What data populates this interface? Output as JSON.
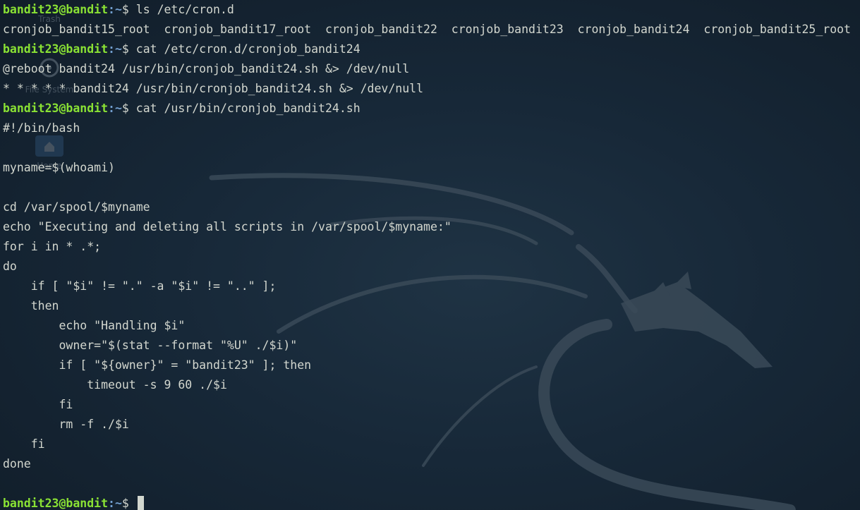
{
  "theme": {
    "background": "#172838",
    "foreground": "#d3d7cf",
    "prompt_user_color": "#8ae234",
    "prompt_path_color": "#729fcf"
  },
  "desktop_icons": [
    {
      "label": "Trash",
      "icon": "trash-icon"
    },
    {
      "label": "File System",
      "icon": "file-system-icon"
    },
    {
      "label": "Home",
      "icon": "home-icon"
    }
  ],
  "terminal": {
    "lines": [
      {
        "kind": "prompt",
        "user": "bandit23@bandit",
        "path": "~",
        "symbol": "$",
        "command": "ls /etc/cron.d"
      },
      {
        "kind": "output",
        "text": "cronjob_bandit15_root  cronjob_bandit17_root  cronjob_bandit22  cronjob_bandit23  cronjob_bandit24  cronjob_bandit25_root"
      },
      {
        "kind": "prompt",
        "user": "bandit23@bandit",
        "path": "~",
        "symbol": "$",
        "command": "cat /etc/cron.d/cronjob_bandit24"
      },
      {
        "kind": "output",
        "text": "@reboot bandit24 /usr/bin/cronjob_bandit24.sh &> /dev/null"
      },
      {
        "kind": "output",
        "text": "* * * * * bandit24 /usr/bin/cronjob_bandit24.sh &> /dev/null"
      },
      {
        "kind": "prompt",
        "user": "bandit23@bandit",
        "path": "~",
        "symbol": "$",
        "command": "cat /usr/bin/cronjob_bandit24.sh"
      },
      {
        "kind": "output",
        "text": "#!/bin/bash"
      },
      {
        "kind": "output",
        "text": ""
      },
      {
        "kind": "output",
        "text": "myname=$(whoami)"
      },
      {
        "kind": "output",
        "text": ""
      },
      {
        "kind": "output",
        "text": "cd /var/spool/$myname"
      },
      {
        "kind": "output",
        "text": "echo \"Executing and deleting all scripts in /var/spool/$myname:\""
      },
      {
        "kind": "output",
        "text": "for i in * .*;"
      },
      {
        "kind": "output",
        "text": "do"
      },
      {
        "kind": "output",
        "text": "    if [ \"$i\" != \".\" -a \"$i\" != \"..\" ];"
      },
      {
        "kind": "output",
        "text": "    then"
      },
      {
        "kind": "output",
        "text": "        echo \"Handling $i\""
      },
      {
        "kind": "output",
        "text": "        owner=\"$(stat --format \"%U\" ./$i)\""
      },
      {
        "kind": "output",
        "text": "        if [ \"${owner}\" = \"bandit23\" ]; then"
      },
      {
        "kind": "output",
        "text": "            timeout -s 9 60 ./$i"
      },
      {
        "kind": "output",
        "text": "        fi"
      },
      {
        "kind": "output",
        "text": "        rm -f ./$i"
      },
      {
        "kind": "output",
        "text": "    fi"
      },
      {
        "kind": "output",
        "text": "done"
      },
      {
        "kind": "output",
        "text": ""
      },
      {
        "kind": "prompt",
        "user": "bandit23@bandit",
        "path": "~",
        "symbol": "$",
        "command": "",
        "cursor": true
      }
    ]
  }
}
